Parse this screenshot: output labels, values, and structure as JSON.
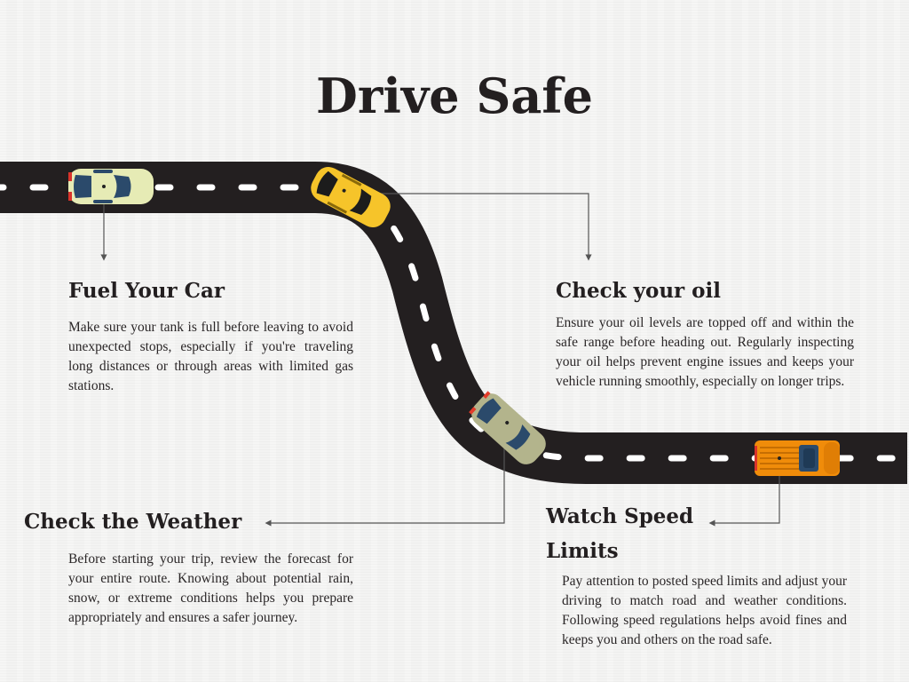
{
  "title": "Drive Safe",
  "colors": {
    "road": "#231f20",
    "lane_marking": "#ffffff",
    "connector": "#555555",
    "text": "#231f20",
    "background": "#f3f3f2"
  },
  "cars": [
    {
      "name": "cream-sedan",
      "body_color": "#e6ebb5",
      "window_color": "#2b4a6b"
    },
    {
      "name": "yellow-hatchback",
      "body_color": "#f6c42a",
      "window_color": "#1c1c1c"
    },
    {
      "name": "olive-sedan",
      "body_color": "#b3b48c",
      "window_color": "#2b4a6b"
    },
    {
      "name": "orange-suv",
      "body_color": "#f08c0a",
      "window_color": "#2b4a6b"
    }
  ],
  "sections": {
    "fuel": {
      "heading": "Fuel Your Car",
      "body": "Make sure your tank is full before leaving to avoid unexpected stops, especially if you're traveling long distances or through areas with limited gas stations."
    },
    "oil": {
      "heading": "Check your oil",
      "body": "Ensure your oil levels are topped off and within the safe range before heading out. Regularly inspecting your oil helps prevent engine issues and keeps your vehicle running smoothly, especially on longer trips."
    },
    "weather": {
      "heading": "Check the Weather",
      "body": "Before starting your trip, review the forecast for your entire route. Knowing about potential rain, snow, or extreme conditions helps you prepare appropriately and ensures a safer journey."
    },
    "speed": {
      "heading": "Watch Speed Limits",
      "body": "Pay attention to posted speed limits and adjust your driving to match road and weather conditions. Following speed regulations helps avoid fines and keeps you and others on the road safe."
    }
  }
}
